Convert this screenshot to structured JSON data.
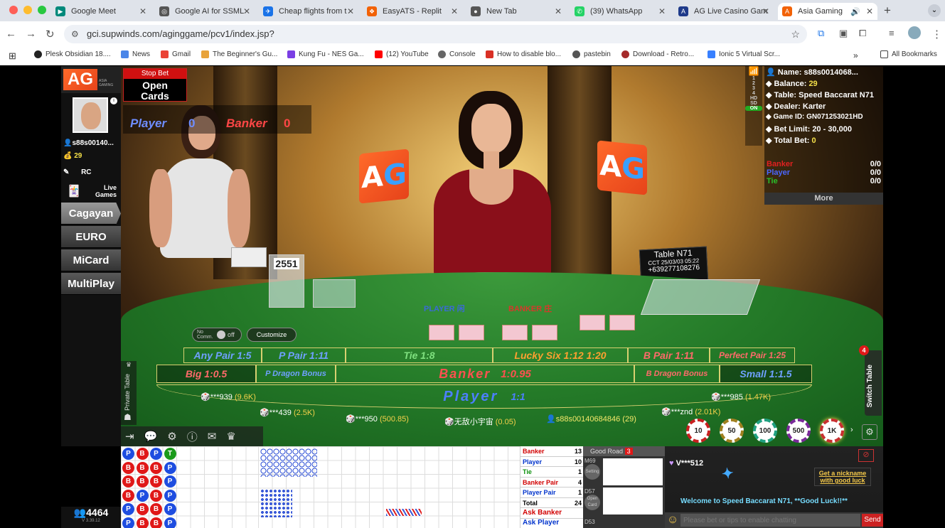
{
  "browser": {
    "tabs": [
      {
        "label": "Google Meet",
        "color": "#00897b"
      },
      {
        "label": "Google AI for SSML",
        "color": "#555555"
      },
      {
        "label": "Cheap flights from t",
        "color": "#1a73e8"
      },
      {
        "label": "EasyATS - Replit",
        "color": "#f26207"
      },
      {
        "label": "New Tab",
        "color": "#555555"
      },
      {
        "label": "(39) WhatsApp",
        "color": "#25d366"
      },
      {
        "label": "AG Live Casino Gam",
        "color": "#1e3a8a"
      },
      {
        "label": "Asia Gaming",
        "color": "#f26207"
      }
    ],
    "url": "gci.supwinds.com/aginggame/pcv1/index.jsp?",
    "bookmarks": [
      "Plesk Obsidian 18....",
      "News",
      "Gmail",
      "The Beginner's Gu...",
      "Kung Fu - NES Ga...",
      "(12) YouTube",
      "Console",
      "How to disable blo...",
      "pastebin",
      "Download - Retro...",
      "Ionic 5 Virtual Scr..."
    ],
    "all_bookmarks": "All Bookmarks"
  },
  "left": {
    "logo": "AG",
    "logo_sub": "ASIA GAMING",
    "username": "s88s00140...",
    "balance": "29",
    "rc": "RC",
    "live_games": "Live Games",
    "menu": [
      "Cagayan",
      "EURO",
      "MiCard",
      "MultiPlay"
    ],
    "online": "4464",
    "version": "V 3.39.12"
  },
  "stop_bet": {
    "label": "Stop Bet",
    "action": "Open Cards"
  },
  "score": {
    "player_label": "Player",
    "player": "0",
    "banker_label": "Banker",
    "banker": "0"
  },
  "info": {
    "name_label": "Name:",
    "name": "s88s0014068...",
    "balance_label": "Balance:",
    "balance": "29",
    "table_label": "Table:",
    "table": "Speed Baccarat N71",
    "dealer_label": "Dealer:",
    "dealer": "Karter",
    "game_label": "Game ID:",
    "game": "GN071253021HD",
    "limit_label": "Bet Limit:",
    "limit": "20 - 30,000",
    "totalbet_label": "Total Bet:",
    "totalbet": "0",
    "rows": [
      {
        "label": "Banker",
        "value": "0/0"
      },
      {
        "label": "Player",
        "value": "0/0"
      },
      {
        "label": "Tie",
        "value": "0/0"
      }
    ],
    "more": "More",
    "side_nums": [
      "1",
      "2",
      "3",
      "4",
      "HD",
      "SD",
      "ON"
    ]
  },
  "table_sign": {
    "name": "Table N71",
    "cct": "CCT 25/03/03 05:22",
    "phone": "+639277108276"
  },
  "shoe_card": "2551",
  "felt": {
    "player_zh": "PLAYER 闲",
    "banker_zh": "BANKER 庄"
  },
  "commission": {
    "label": "No Comm.",
    "toggle": "off",
    "customize": "Customize"
  },
  "bets": {
    "any_pair": "Any Pair 1:5",
    "p_pair": "P Pair 1:11",
    "tie": "Tie 1:8",
    "lucky_six": "Lucky Six 1:12 1:20",
    "b_pair": "B Pair 1:11",
    "perfect_pair": "Perfect Pair 1:25",
    "big": "Big 1:0.5",
    "p_dragon": "P Dragon Bonus",
    "banker": "Banker",
    "banker_odds": "1:0.95",
    "b_dragon": "B Dragon Bonus",
    "small": "Small 1:1.5",
    "player": "Player",
    "player_odds": "1:1",
    "q": "?"
  },
  "players": [
    {
      "name": "***939",
      "amt": "(9.6K)"
    },
    {
      "name": "***439",
      "amt": "(2.5K)"
    },
    {
      "name": "***950",
      "amt": "(500.85)"
    },
    {
      "name": "无敌小宇宙",
      "amt": "(0.05)"
    },
    {
      "name": "s88s00140684846",
      "amt": "(29)"
    },
    {
      "name": "***znd",
      "amt": "(2.01K)"
    },
    {
      "name": "***985",
      "amt": "(1.47K)"
    }
  ],
  "chips": [
    "10",
    "50",
    "100",
    "500",
    "1K"
  ],
  "switch_table": "Switch Table",
  "switch_count": "4",
  "private_table": "Private Table",
  "stats": [
    {
      "label": "Banker",
      "value": "13",
      "color": "#d10000"
    },
    {
      "label": "Player",
      "value": "10",
      "color": "#0033cc"
    },
    {
      "label": "Tie",
      "value": "1",
      "color": "#0a8f0a"
    },
    {
      "label": "Banker Pair",
      "value": "4",
      "color": "#d10000"
    },
    {
      "label": "Player Pair",
      "value": "1",
      "color": "#0033cc"
    },
    {
      "label": "Total",
      "value": "24",
      "color": "#000000"
    }
  ],
  "ask_banker": "Ask Banker",
  "ask_player": "Ask Player",
  "good_road": {
    "label": "Good Road",
    "count": "3",
    "tables": [
      "M69",
      "D57",
      "D53"
    ],
    "side": [
      "Setting",
      "Open Card"
    ]
  },
  "chat": {
    "user": "V***512",
    "nickname": "Get a nickname with good luck",
    "welcome": "Welcome to Speed Baccarat N71, **Good Luck!!**",
    "placeholder": "Please bet or tips to enable chatting",
    "send": "Send"
  },
  "bead_road": [
    [
      "P",
      "B",
      "P",
      "T"
    ],
    [
      "B",
      "B",
      "B",
      "P"
    ],
    [
      "B",
      "B",
      "B",
      "P"
    ],
    [
      "B",
      "P",
      "B",
      "P"
    ],
    [
      "P",
      "B",
      "B",
      "P"
    ],
    [
      "P",
      "B",
      "B",
      "P"
    ]
  ]
}
